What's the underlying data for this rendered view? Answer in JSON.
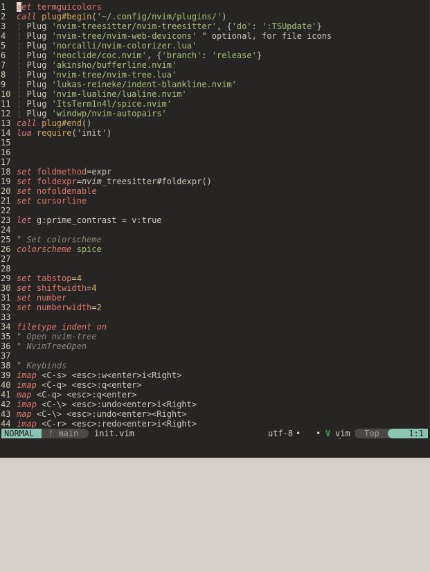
{
  "editor": {
    "lines": [
      {
        "num": "1",
        "cursor_char": "s",
        "tokens": [
          {
            "t": "et ",
            "c": "kw"
          },
          {
            "t": "termguicolors",
            "c": "opt"
          }
        ]
      },
      {
        "num": "2",
        "tokens": [
          {
            "t": "call ",
            "c": "kw"
          },
          {
            "t": "plug#begin",
            "c": "fn"
          },
          {
            "t": "(",
            "c": "punct"
          },
          {
            "t": "'~/.config/nvim/plugins/'",
            "c": "str"
          },
          {
            "t": ")",
            "c": "punct"
          }
        ]
      },
      {
        "num": "3",
        "tokens": [
          {
            "t": "¦ ",
            "c": "bar"
          },
          {
            "t": "Plug ",
            "c": "pl"
          },
          {
            "t": "'nvim-treesitter/nvim-treesitter'",
            "c": "str"
          },
          {
            "t": ", {",
            "c": "punct"
          },
          {
            "t": "'do'",
            "c": "str"
          },
          {
            "t": ": ",
            "c": "punct"
          },
          {
            "t": "':TSUpdate'",
            "c": "str"
          },
          {
            "t": "}",
            "c": "punct"
          }
        ]
      },
      {
        "num": "4",
        "tokens": [
          {
            "t": "¦ ",
            "c": "bar"
          },
          {
            "t": "Plug ",
            "c": "pl"
          },
          {
            "t": "'nvim-tree/nvim-web-devicons'",
            "c": "str"
          },
          {
            "t": " \" optional, for file icons",
            "c": "pl"
          }
        ]
      },
      {
        "num": "5",
        "tokens": [
          {
            "t": "¦ ",
            "c": "bar"
          },
          {
            "t": "Plug ",
            "c": "pl"
          },
          {
            "t": "'norcalli/nvim-colorizer.lua'",
            "c": "str"
          }
        ]
      },
      {
        "num": "6",
        "tokens": [
          {
            "t": "¦ ",
            "c": "bar"
          },
          {
            "t": "Plug ",
            "c": "pl"
          },
          {
            "t": "'neoclide/coc.nvim'",
            "c": "str"
          },
          {
            "t": ", {",
            "c": "punct"
          },
          {
            "t": "'branch'",
            "c": "str"
          },
          {
            "t": ": ",
            "c": "punct"
          },
          {
            "t": "'release'",
            "c": "str"
          },
          {
            "t": "}",
            "c": "punct"
          }
        ]
      },
      {
        "num": "7",
        "tokens": [
          {
            "t": "¦ ",
            "c": "bar"
          },
          {
            "t": "Plug ",
            "c": "pl"
          },
          {
            "t": "'akinsho/bufferline.nvim'",
            "c": "str"
          }
        ]
      },
      {
        "num": "8",
        "tokens": [
          {
            "t": "¦ ",
            "c": "bar"
          },
          {
            "t": "Plug ",
            "c": "pl"
          },
          {
            "t": "'nvim-tree/nvim-tree.lua'",
            "c": "str"
          }
        ]
      },
      {
        "num": "9",
        "tokens": [
          {
            "t": "¦ ",
            "c": "bar"
          },
          {
            "t": "Plug ",
            "c": "pl"
          },
          {
            "t": "'lukas-reineke/indent-blankline.nvim'",
            "c": "str"
          }
        ]
      },
      {
        "num": "10",
        "tokens": [
          {
            "t": "¦ ",
            "c": "bar"
          },
          {
            "t": "Plug ",
            "c": "pl"
          },
          {
            "t": "'nvim-lualine/lualine.nvim'",
            "c": "str"
          }
        ]
      },
      {
        "num": "11",
        "tokens": [
          {
            "t": "¦ ",
            "c": "bar"
          },
          {
            "t": "Plug ",
            "c": "pl"
          },
          {
            "t": "'ItsTerm1n4l/spice.nvim'",
            "c": "str"
          }
        ]
      },
      {
        "num": "12",
        "tokens": [
          {
            "t": "¦ ",
            "c": "bar"
          },
          {
            "t": "Plug ",
            "c": "pl"
          },
          {
            "t": "'windwp/nvim-autopairs'",
            "c": "str"
          }
        ]
      },
      {
        "num": "13",
        "tokens": [
          {
            "t": "call ",
            "c": "kw"
          },
          {
            "t": "plug#end",
            "c": "fn"
          },
          {
            "t": "()",
            "c": "punct"
          }
        ]
      },
      {
        "num": "14",
        "tokens": [
          {
            "t": "lua ",
            "c": "kw"
          },
          {
            "t": "require",
            "c": "fn"
          },
          {
            "t": "('init')",
            "c": "punct"
          }
        ]
      },
      {
        "num": "15",
        "tokens": []
      },
      {
        "num": "16",
        "tokens": []
      },
      {
        "num": "17",
        "tokens": []
      },
      {
        "num": "18",
        "tokens": [
          {
            "t": "set ",
            "c": "kw"
          },
          {
            "t": "foldmethod",
            "c": "opt"
          },
          {
            "t": "=expr",
            "c": "punct"
          }
        ]
      },
      {
        "num": "19",
        "tokens": [
          {
            "t": "set ",
            "c": "kw"
          },
          {
            "t": "foldexpr",
            "c": "opt"
          },
          {
            "t": "=",
            "c": "punct"
          },
          {
            "t": "nvim",
            "c": "ital"
          },
          {
            "t": "_treesitter#foldexpr()",
            "c": "punct"
          }
        ]
      },
      {
        "num": "20",
        "tokens": [
          {
            "t": "set ",
            "c": "kw"
          },
          {
            "t": "nofoldenable",
            "c": "opt"
          }
        ]
      },
      {
        "num": "21",
        "tokens": [
          {
            "t": "set ",
            "c": "kw"
          },
          {
            "t": "cursorline",
            "c": "opt"
          }
        ]
      },
      {
        "num": "22",
        "tokens": []
      },
      {
        "num": "23",
        "tokens": [
          {
            "t": "let ",
            "c": "kw"
          },
          {
            "t": "g:prime_contrast = v:true",
            "c": "punct"
          }
        ]
      },
      {
        "num": "24",
        "tokens": []
      },
      {
        "num": "25",
        "tokens": [
          {
            "t": "\" Set colorscheme",
            "c": "cmt"
          }
        ]
      },
      {
        "num": "26",
        "tokens": [
          {
            "t": "colorscheme ",
            "c": "kw"
          },
          {
            "t": "spice",
            "c": "str"
          }
        ]
      },
      {
        "num": "27",
        "tokens": []
      },
      {
        "num": "28",
        "tokens": []
      },
      {
        "num": "29",
        "tokens": [
          {
            "t": "set ",
            "c": "kw"
          },
          {
            "t": "tabstop",
            "c": "opt"
          },
          {
            "t": "=",
            "c": "punct"
          },
          {
            "t": "4",
            "c": "num"
          }
        ]
      },
      {
        "num": "30",
        "tokens": [
          {
            "t": "set ",
            "c": "kw"
          },
          {
            "t": "shiftwidth",
            "c": "opt"
          },
          {
            "t": "=",
            "c": "punct"
          },
          {
            "t": "4",
            "c": "num"
          }
        ]
      },
      {
        "num": "31",
        "tokens": [
          {
            "t": "set ",
            "c": "kw"
          },
          {
            "t": "number",
            "c": "opt"
          }
        ]
      },
      {
        "num": "32",
        "tokens": [
          {
            "t": "set ",
            "c": "kw"
          },
          {
            "t": "numberwidth",
            "c": "opt"
          },
          {
            "t": "=",
            "c": "punct"
          },
          {
            "t": "2",
            "c": "num"
          }
        ]
      },
      {
        "num": "33",
        "tokens": []
      },
      {
        "num": "34",
        "tokens": [
          {
            "t": "filetype ",
            "c": "kw"
          },
          {
            "t": "indent on",
            "c": "kw"
          }
        ]
      },
      {
        "num": "35",
        "tokens": [
          {
            "t": "\" Open nvim-tree",
            "c": "cmt"
          }
        ]
      },
      {
        "num": "36",
        "tokens": [
          {
            "t": "\" NvimTreeOpen",
            "c": "cmt"
          }
        ]
      },
      {
        "num": "37",
        "tokens": []
      },
      {
        "num": "38",
        "tokens": [
          {
            "t": "\" Keybinds",
            "c": "cmt"
          }
        ]
      },
      {
        "num": "39",
        "tokens": [
          {
            "t": "imap ",
            "c": "kw"
          },
          {
            "t": "<C-s> <esc>:w<enter>i<Right>",
            "c": "punct"
          }
        ]
      },
      {
        "num": "40",
        "tokens": [
          {
            "t": "imap ",
            "c": "kw"
          },
          {
            "t": "<C-q> <esc>:q<enter>",
            "c": "punct"
          }
        ]
      },
      {
        "num": "41",
        "tokens": [
          {
            "t": "map ",
            "c": "kw"
          },
          {
            "t": "<C-q> <esc>:q<enter>",
            "c": "punct"
          }
        ]
      },
      {
        "num": "42",
        "tokens": [
          {
            "t": "imap ",
            "c": "kw"
          },
          {
            "t": "<C-\\> <esc>:undo<enter>i<Right>",
            "c": "punct"
          }
        ]
      },
      {
        "num": "43",
        "tokens": [
          {
            "t": "map ",
            "c": "kw"
          },
          {
            "t": "<C-\\> <esc>:undo<enter><Right>",
            "c": "punct"
          }
        ]
      },
      {
        "num": "44",
        "tokens": [
          {
            "t": "imap ",
            "c": "kw"
          },
          {
            "t": "<C-r> <esc>:redo<enter>i<Right>",
            "c": "punct"
          }
        ]
      }
    ]
  },
  "statusline": {
    "mode": "NORMAL",
    "branch_icon": "ᚠ",
    "branch": "main",
    "filename": "init.vim",
    "encoding": "utf-8",
    "separator": "•",
    "os_icon": "🐧",
    "os_icon_name": "linux-icon",
    "vim_icon": "V",
    "filetype": "vim",
    "position": "Top",
    "lineinfo": "1:1"
  },
  "colors": {
    "background": "#262523",
    "accent": "#8cc4b3",
    "keyword": "#e0776f",
    "string": "#a9c47a",
    "function": "#d6aa5c"
  }
}
